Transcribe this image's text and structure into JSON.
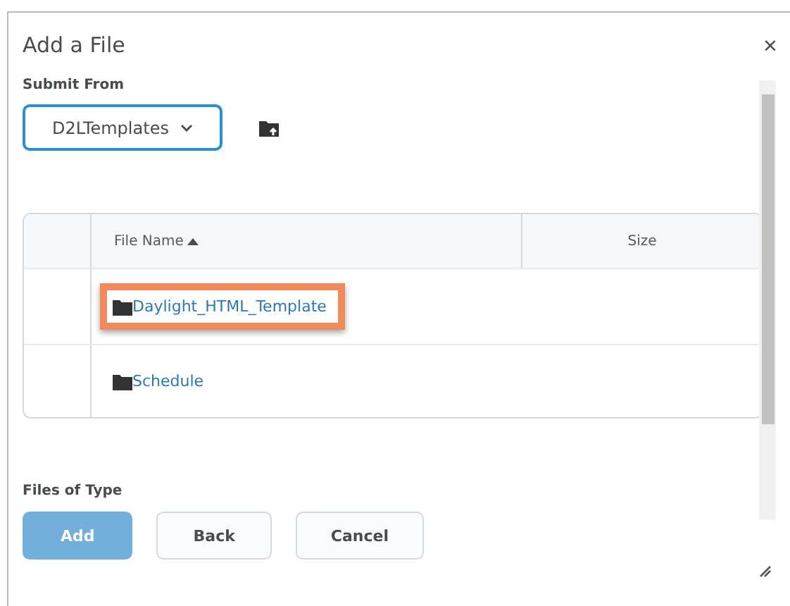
{
  "dialog": {
    "title": "Add a File",
    "close": "×"
  },
  "submit_from": {
    "label": "Submit From",
    "value": "D2LTemplates"
  },
  "table": {
    "columns": [
      {
        "label": "File Name",
        "sorted": true
      },
      {
        "label": "Size",
        "sorted": false
      }
    ],
    "rows": [
      {
        "name": "Daylight_HTML_Template",
        "kind": "folder",
        "highlighted": true
      },
      {
        "name": "Schedule",
        "kind": "folder",
        "highlighted": false
      }
    ]
  },
  "files_of_type": {
    "label": "Files of Type"
  },
  "buttons": [
    {
      "label": "Add",
      "primary": true,
      "disabled": true
    },
    {
      "label": "Back",
      "primary": false,
      "disabled": false
    },
    {
      "label": "Cancel",
      "primary": false,
      "disabled": false
    }
  ]
}
